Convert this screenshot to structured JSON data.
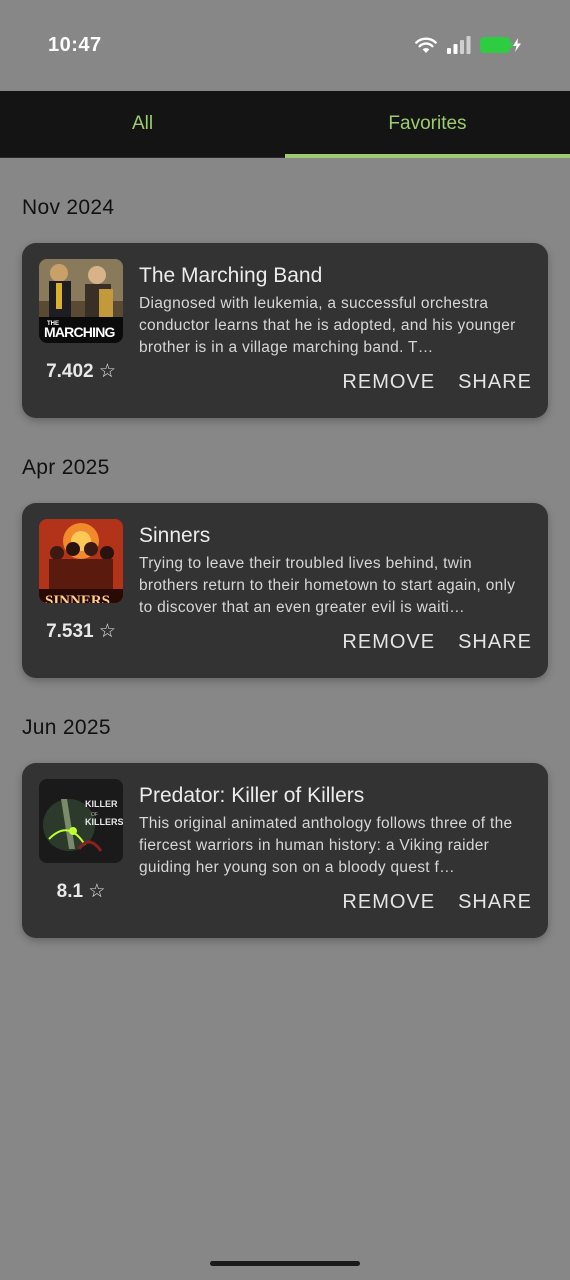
{
  "status_bar": {
    "time": "10:47",
    "battery_color": "#2ecc40"
  },
  "tabs": [
    {
      "label": "All",
      "active": false
    },
    {
      "label": "Favorites",
      "active": true
    }
  ],
  "accent_color": "#9ccc6f",
  "groups": [
    {
      "month": "Nov 2024",
      "item": {
        "title": "The Marching Band",
        "description": "Diagnosed with leukemia, a successful orchestra conductor learns that he is adopted, and his younger brother is in a village marching band. T…",
        "rating": "7.402 ☆",
        "poster_text": "THE MARCHING BAND",
        "remove_label": "REMOVE",
        "share_label": "SHARE"
      }
    },
    {
      "month": "Apr 2025",
      "item": {
        "title": "Sinners",
        "description": "Trying to leave their troubled lives behind, twin brothers return to their hometown to start again, only to discover that an even greater evil is waiti…",
        "rating": "7.531 ☆",
        "poster_text": "SINNERS",
        "remove_label": "REMOVE",
        "share_label": "SHARE"
      }
    },
    {
      "month": "Jun 2025",
      "item": {
        "title": "Predator: Killer of Killers",
        "description": "This original animated anthology follows three of the fiercest warriors in human history: a Viking raider guiding her young son on a bloody quest f…",
        "rating": "8.1 ☆",
        "poster_text": "KILLER OF KILLERS",
        "remove_label": "REMOVE",
        "share_label": "SHARE"
      }
    }
  ]
}
